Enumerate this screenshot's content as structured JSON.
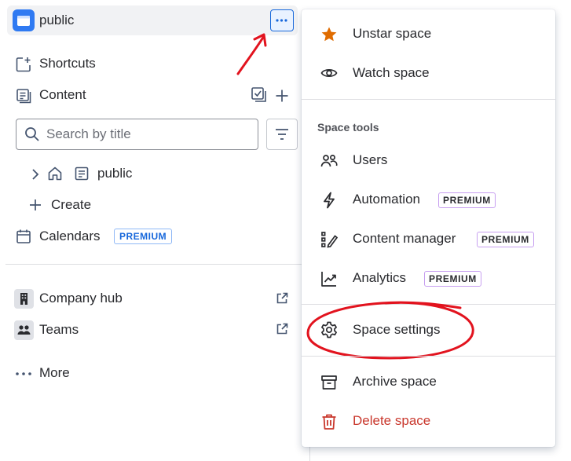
{
  "sidebar": {
    "space_name": "public",
    "shortcuts": "Shortcuts",
    "content": "Content",
    "search_placeholder": "Search by title",
    "tree_item": "public",
    "create": "Create",
    "calendars": "Calendars",
    "calendars_badge": "PREMIUM",
    "company_hub": "Company hub",
    "teams": "Teams",
    "more": "More"
  },
  "menu": {
    "unstar": "Unstar space",
    "watch": "Watch space",
    "section_label": "Space tools",
    "users": "Users",
    "automation": "Automation",
    "content_manager": "Content manager",
    "analytics": "Analytics",
    "premium": "PREMIUM",
    "space_settings": "Space settings",
    "archive": "Archive space",
    "delete": "Delete space"
  },
  "colors": {
    "accent_blue": "#1868db",
    "star_orange": "#e06c00",
    "danger_red": "#c9372c",
    "annotation_red": "#e2131e"
  },
  "icons": [
    "space-folder-icon",
    "more-icon",
    "shortcut-add-icon",
    "pages-icon",
    "bulk-select-icon",
    "add-icon",
    "search-icon",
    "filter-icon",
    "chevron-right-icon",
    "home-icon",
    "page-icon",
    "plus-icon",
    "calendar-icon",
    "building-icon",
    "teams-icon",
    "external-link-icon",
    "more-dots-icon",
    "star-icon",
    "eye-icon",
    "people-icon",
    "lightning-icon",
    "content-manager-icon",
    "chart-icon",
    "gear-icon",
    "archive-icon",
    "trash-icon"
  ]
}
